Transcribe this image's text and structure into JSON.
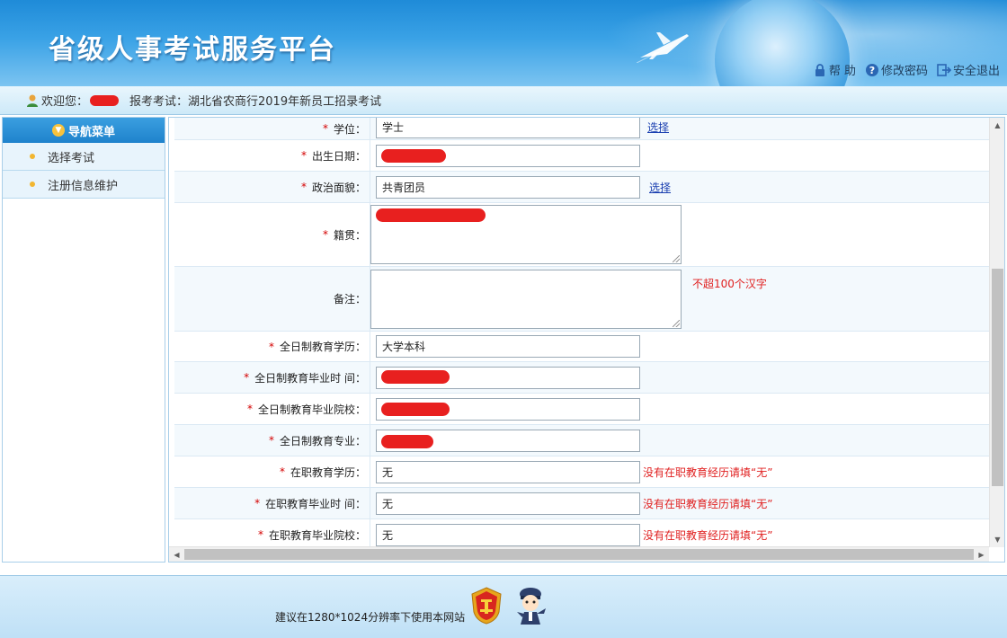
{
  "header": {
    "title": "省级人事考试服务平台",
    "links": [
      {
        "label": "帮 助",
        "icon": "lock-icon"
      },
      {
        "label": "修改密码",
        "icon": "help-circle-icon"
      },
      {
        "label": "安全退出",
        "icon": "logout-icon"
      }
    ]
  },
  "welcome": {
    "greeting": "欢迎您：",
    "exam_label": "报考考试：湖北省农商行2019年新员工招录考试"
  },
  "sidebar": {
    "title": "导航菜单",
    "items": [
      {
        "label": "选择考试"
      },
      {
        "label": "注册信息维护"
      }
    ]
  },
  "form": {
    "rows": [
      {
        "label": "学位：",
        "required": true,
        "value": "学士",
        "link": "选择"
      },
      {
        "label": "出生日期：",
        "required": true,
        "value": ""
      },
      {
        "label": "政治面貌：",
        "required": true,
        "value": "共青团员",
        "link": "选择"
      },
      {
        "label": "籍贯：",
        "required": true,
        "value": ""
      },
      {
        "label": "备注：",
        "required": false,
        "value": "",
        "hint": "不超100个汉字"
      },
      {
        "label": "全日制教育学历：",
        "required": true,
        "value": "大学本科"
      },
      {
        "label": "全日制教育毕业时 间：",
        "required": true,
        "value": ""
      },
      {
        "label": "全日制教育毕业院校：",
        "required": true,
        "value": ""
      },
      {
        "label": "全日制教育专业：",
        "required": true,
        "value": ""
      },
      {
        "label": "在职教育学历：",
        "required": true,
        "value": "无",
        "hint": "没有在职教育经历请填“无”"
      },
      {
        "label": "在职教育毕业时 间：",
        "required": true,
        "value": "无",
        "hint": "没有在职教育经历请填“无”"
      },
      {
        "label": "在职教育毕业院校：",
        "required": true,
        "value": "无",
        "hint": "没有在职教育经历请填“无”"
      }
    ],
    "required_mark": "*"
  },
  "footer": {
    "text": "建议在1280*1024分辨率下使用本网站"
  },
  "colors": {
    "header_blue": "#2a8fdb",
    "required_red": "#d40000",
    "hint_red": "#e02020",
    "link_blue": "#1a3fb0"
  }
}
